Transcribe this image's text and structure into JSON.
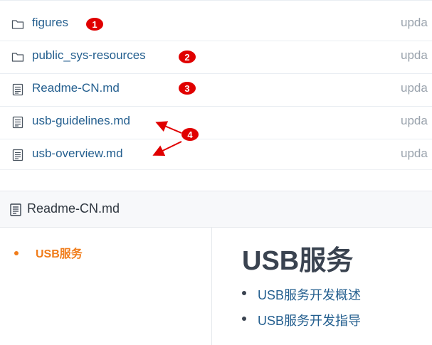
{
  "file_list": {
    "rows": [
      {
        "icon": "folder-icon",
        "name": "figures",
        "message": "upda"
      },
      {
        "icon": "folder-icon",
        "name": "public_sys-resources",
        "message": "upda"
      },
      {
        "icon": "file-icon",
        "name": "Readme-CN.md",
        "message": "upda"
      },
      {
        "icon": "file-icon",
        "name": "usb-guidelines.md",
        "message": "upda"
      },
      {
        "icon": "file-icon",
        "name": "usb-overview.md",
        "message": "upda"
      }
    ]
  },
  "readme": {
    "icon": "file-icon",
    "title": "Readme-CN.md",
    "toc": {
      "items": [
        {
          "label": "USB服务"
        }
      ],
      "accent_color": "#f07c1a"
    },
    "heading": "USB服务",
    "links": [
      {
        "label": "USB服务开发概述"
      },
      {
        "label": "USB服务开发指导"
      }
    ]
  },
  "annotations": {
    "color": "#e00000",
    "markers": [
      "1",
      "2",
      "3",
      "4"
    ]
  },
  "colors": {
    "link": "#245f8f",
    "muted": "#9aa3ad",
    "heading": "#3a4350"
  }
}
